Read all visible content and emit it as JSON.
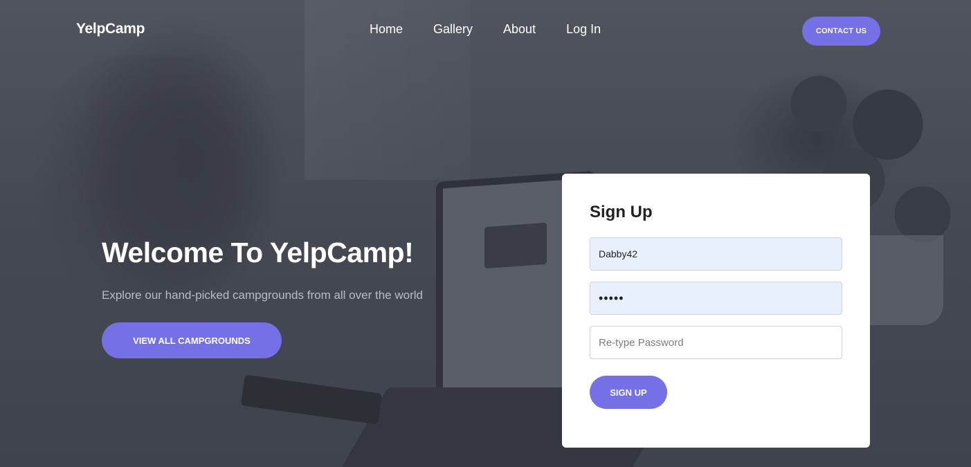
{
  "nav": {
    "brand": "YelpCamp",
    "links": [
      "Home",
      "Gallery",
      "About",
      "Log In"
    ],
    "contact_label": "CONTACT US"
  },
  "hero": {
    "title": "Welcome To YelpCamp!",
    "subtitle": "Explore our hand-picked campgrounds from all over the world",
    "button_label": "VIEW ALL CAMPGROUNDS"
  },
  "signup": {
    "title": "Sign Up",
    "username_value": "Dabby42",
    "password_value": "•••••",
    "retype_placeholder": "Re-type Password",
    "button_label": "SIGN UP"
  },
  "colors": {
    "accent": "#7570e6",
    "autofill_bg": "#e8f0fe"
  }
}
